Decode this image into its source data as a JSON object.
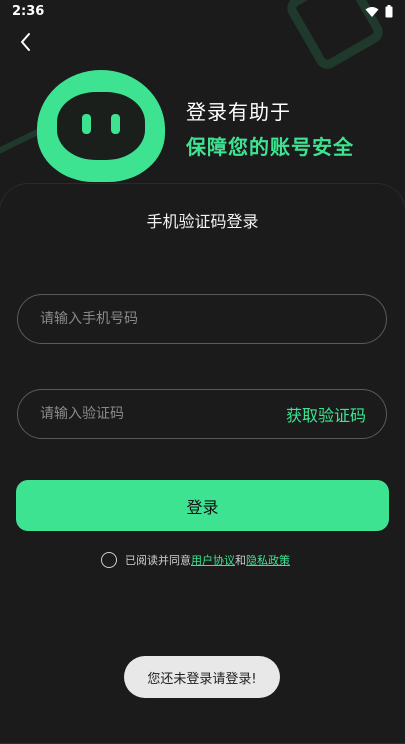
{
  "status": {
    "time": "2:36",
    "icons": [
      "wifi-icon",
      "battery-icon"
    ]
  },
  "header": {
    "back_icon": "chevron-left-icon"
  },
  "slogan": {
    "line1": "登录有助于",
    "line2": "保障您的账号安全"
  },
  "form": {
    "title": "手机验证码登录",
    "phone_placeholder": "请输入手机号码",
    "phone_value": "",
    "code_placeholder": "请输入验证码",
    "code_value": "",
    "get_code_label": "获取验证码",
    "login_label": "登录"
  },
  "agreement": {
    "prefix": "已阅读并同意",
    "user_agreement": "用户协议",
    "and": "和",
    "privacy_policy": "隐私政策",
    "checked": false
  },
  "toast": {
    "message": "您还未登录请登录!"
  },
  "colors": {
    "accent": "#3ee392",
    "background": "#1b1b1b",
    "toast_bg": "#e8e8e8"
  }
}
